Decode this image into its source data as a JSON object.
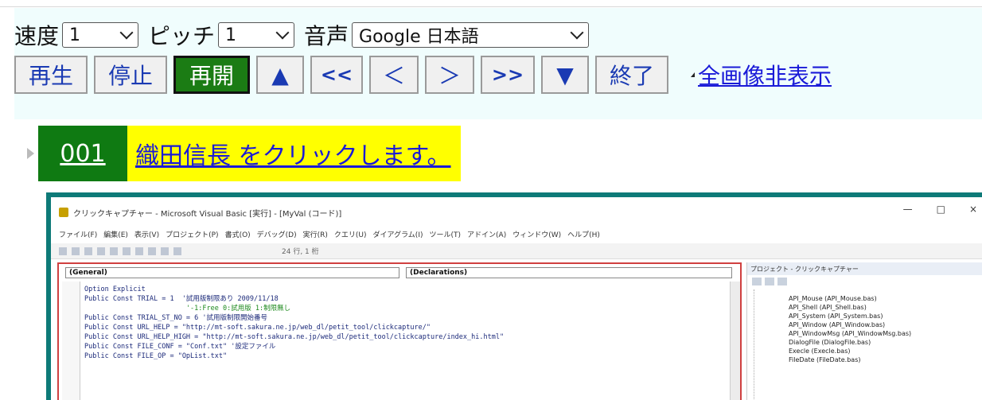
{
  "controls": {
    "speed_label": "速度",
    "speed_value": "1",
    "pitch_label": "ピッチ",
    "pitch_value": "1",
    "voice_label": "音声",
    "voice_value": "Google 日本語"
  },
  "buttons": {
    "play": "再生",
    "stop": "停止",
    "resume": "再開",
    "up": "▲",
    "first": "<<",
    "prev": "＜",
    "next": "＞",
    "last": ">>",
    "down": "▼",
    "exit": "終了"
  },
  "hide_all_images_link": "全画像非表示",
  "step": {
    "number": "001",
    "description": "織田信長 をクリックします。"
  },
  "screenshot": {
    "window_title": "クリックキャプチャー - Microsoft Visual Basic [実行] - [MyVal (コード)]",
    "menu_items": [
      "ファイル(F)",
      "編集(E)",
      "表示(V)",
      "プロジェクト(P)",
      "書式(O)",
      "デバッグ(D)",
      "実行(R)",
      "クエリ(U)",
      "ダイアグラム(I)",
      "ツール(T)",
      "アドイン(A)",
      "ウィンドウ(W)",
      "ヘルプ(H)"
    ],
    "toolbar_position": "24 行, 1 桁",
    "combo_left": "(General)",
    "combo_right": "(Declarations)",
    "code_lines": [
      "Option Explicit",
      "",
      "Public Const TRIAL = 1  '試用版制限あり 2009/11/18",
      "                         '-1:Free 0:試用版 1:制限無し",
      "Public Const TRIAL_ST_NO = 6 '試用版制限開始番号",
      "",
      "Public Const URL_HELP = \"http://mt-soft.sakura.ne.jp/web_dl/petit_tool/clickcapture/\"",
      "Public Const URL_HELP_HIGH = \"http://mt-soft.sakura.ne.jp/web_dl/petit_tool/clickcapture/index_hi.html\"",
      "",
      "",
      "Public Const FILE_CONF = \"Conf.txt\" '設定ファイル",
      "Public Const FILE_OP = \"OpList.txt\""
    ],
    "project_header": "プロジェクト - クリックキャプチャー",
    "tree_items": [
      "API_Mouse (API_Mouse.bas)",
      "API_Shell (API_Shell.bas)",
      "API_System (API_System.bas)",
      "API_Window (API_Window.bas)",
      "API_WindowMsg (API_WindowMsg.bas)",
      "DialogFile (DialogFile.bas)",
      "Execle (Execle.bas)",
      "FileDate (FileDate.bas)"
    ],
    "win_controls": [
      "—",
      "□",
      "×"
    ]
  }
}
